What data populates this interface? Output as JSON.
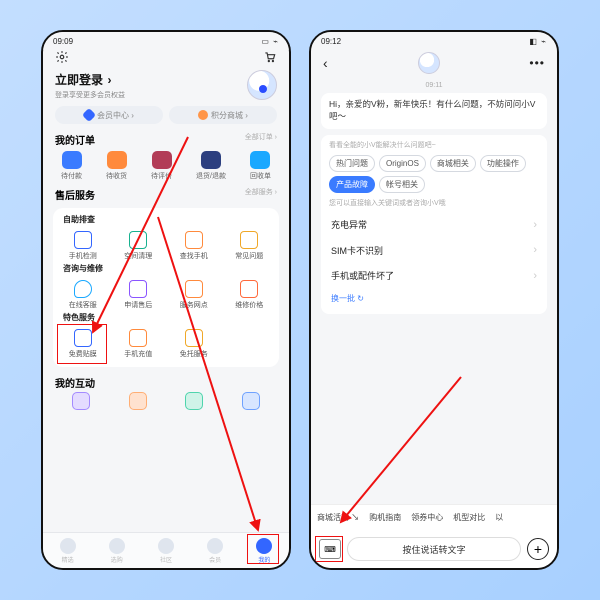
{
  "left": {
    "status": {
      "time": "09:09",
      "icons_left": "◎ ⬒ ✉ ⌁",
      "icons_right": "▭ ⌁"
    },
    "topbar": {
      "settings": "gear-icon",
      "cart": "cart-icon"
    },
    "login": {
      "title": "立即登录",
      "chevron": "›",
      "subtitle": "登录享受更多会员权益"
    },
    "pills": {
      "member": "会员中心 ›",
      "points": "积分商城 ›"
    },
    "orders": {
      "title": "我的订单",
      "more": "全部订单 ›",
      "items": [
        {
          "label": "待付款"
        },
        {
          "label": "待收货"
        },
        {
          "label": "待评价"
        },
        {
          "label": "退货/退款"
        },
        {
          "label": "回收单"
        }
      ]
    },
    "after": {
      "title": "售后服务",
      "more": "全部服务 ›",
      "group1_title": "自助排查",
      "group1": [
        {
          "label": "手机检测"
        },
        {
          "label": "空间清理"
        },
        {
          "label": "查找手机"
        },
        {
          "label": "常见问题"
        }
      ],
      "group2_title": "咨询与维修",
      "group2": [
        {
          "label": "在线客服"
        },
        {
          "label": "申请售后"
        },
        {
          "label": "服务网点"
        },
        {
          "label": "维修价格"
        }
      ],
      "group3_title": "特色服务",
      "group3": [
        {
          "label": "免费贴膜"
        },
        {
          "label": "手机充值"
        },
        {
          "label": "免托服务"
        }
      ]
    },
    "interact": {
      "title": "我的互动",
      "items": [
        {
          "c": "purple"
        },
        {
          "c": "orange"
        },
        {
          "c": "teal"
        },
        {
          "c": "blue"
        }
      ]
    },
    "nav": [
      {
        "label": "精选"
      },
      {
        "label": "选购"
      },
      {
        "label": "社区"
      },
      {
        "label": "会员"
      },
      {
        "label": "我的",
        "active": true
      }
    ]
  },
  "right": {
    "status": {
      "time": "09:12",
      "icons_left": "⬒ ✉ ⌁",
      "icons_right": "◧ ⌁"
    },
    "chat_time": "09:11",
    "greeting": "Hi，亲爱的V粉，新年快乐！有什么问题，不妨问问小V吧～",
    "help_hint": "看看全能的小V能解决什么问题吧~",
    "chips": [
      {
        "label": "热门问题"
      },
      {
        "label": "OriginOS"
      },
      {
        "label": "商城相关"
      },
      {
        "label": "功能操作"
      },
      {
        "label": "产品故障",
        "active": true
      },
      {
        "label": "帐号相关"
      }
    ],
    "faq_hint": "您可以直接输入关键词或者咨询小V哦",
    "faq": [
      "充电异常",
      "SIM卡不识别",
      "手机或配件坏了"
    ],
    "refresh": "换一批 ↻",
    "suggestions": [
      "商城活动 ↘",
      "购机指南",
      "领券中心",
      "机型对比",
      "以"
    ],
    "talk_placeholder": "按住说话转文字"
  }
}
